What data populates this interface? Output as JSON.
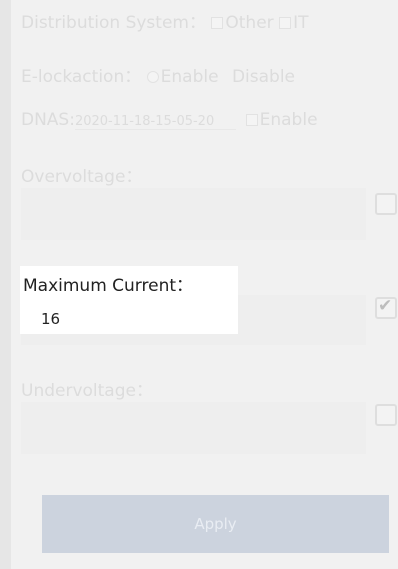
{
  "distribution": {
    "label": "Distribution System：",
    "option_other": "Other",
    "option_it": "IT"
  },
  "elock": {
    "label": "E-lockaction：",
    "option_enable": "Enable",
    "option_disable": "Disable"
  },
  "dnas": {
    "label": "DNAS:",
    "value": "2020-11-18-15-05-20",
    "enable_label": "Enable"
  },
  "overvoltage": {
    "label": "Overvoltage："
  },
  "max_current": {
    "label": "Maximum Current：",
    "value": "16",
    "checked": true
  },
  "undervoltage": {
    "label": "Undervoltage："
  },
  "apply": {
    "label": "Apply"
  },
  "icons": {
    "checkmark": "checkmark-icon"
  },
  "colors": {
    "apply_bg": "#ccd3de",
    "highlight_bg": "#ffffff",
    "dim_text": "#dcdcdc"
  }
}
